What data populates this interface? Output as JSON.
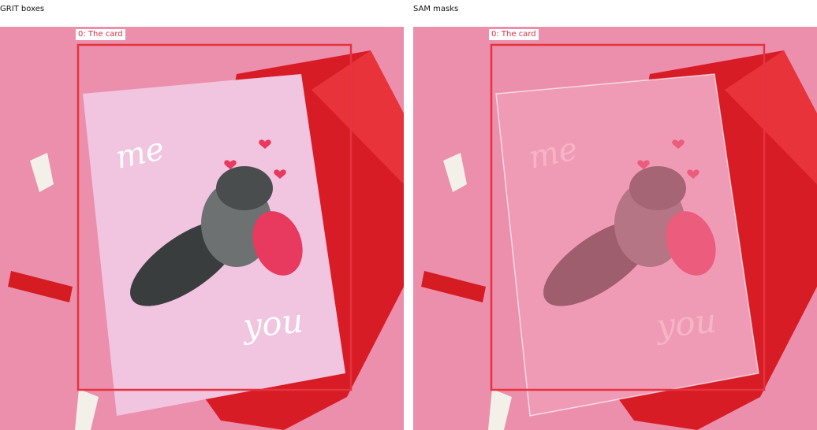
{
  "panels": [
    {
      "title": "GRIT boxes",
      "box_label": "0: The card",
      "mode": "box"
    },
    {
      "title": "SAM masks",
      "box_label": "0: The card",
      "mode": "mask"
    }
  ],
  "card_text": {
    "top": "me",
    "bottom": "you"
  },
  "colors": {
    "background": "#e98aa8",
    "card": "#f1c4e0",
    "envelope": "#d81c26",
    "box": "#e5333f",
    "mask": "#f07a95"
  }
}
